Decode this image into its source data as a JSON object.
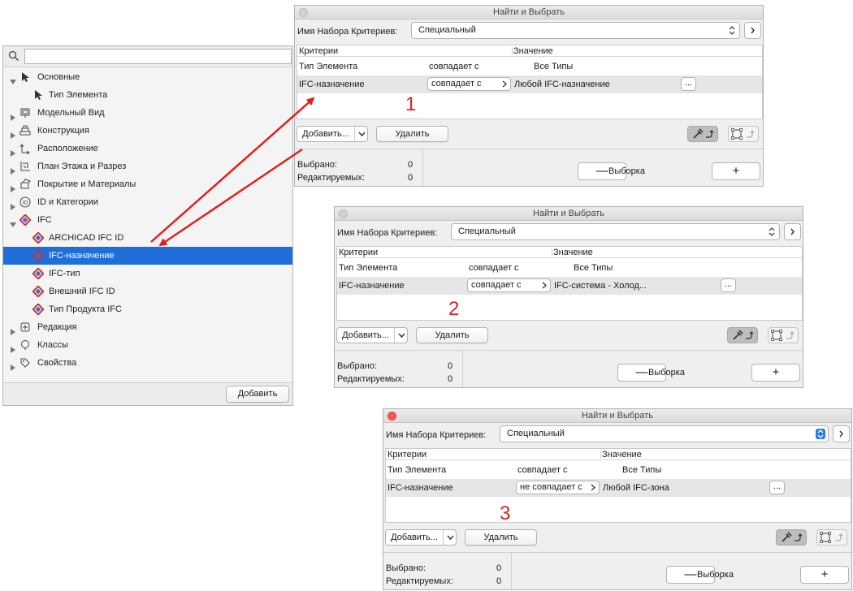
{
  "tree": {
    "search_value": "",
    "items": [
      {
        "label": "Основные",
        "level": 0,
        "expanded": true,
        "icon": "pointer-icon"
      },
      {
        "label": "Тип Элемента",
        "level": 1,
        "icon": "pointer-small-icon"
      },
      {
        "label": "Модельный Вид",
        "level": 0,
        "expanded": false,
        "icon": "model-view-icon"
      },
      {
        "label": "Конструкция",
        "level": 0,
        "expanded": false,
        "icon": "structure-icon"
      },
      {
        "label": "Расположение",
        "level": 0,
        "expanded": false,
        "icon": "location-icon"
      },
      {
        "label": "План Этажа и Разрез",
        "level": 0,
        "expanded": false,
        "icon": "floor-plan-icon"
      },
      {
        "label": "Покрытие и Материалы",
        "level": 0,
        "expanded": false,
        "icon": "surface-icon"
      },
      {
        "label": "ID и Категории",
        "level": 0,
        "expanded": false,
        "icon": "id-icon"
      },
      {
        "label": "IFC",
        "level": 0,
        "expanded": true,
        "icon": "ifc-icon"
      },
      {
        "label": "ARCHICAD IFC ID",
        "level": 1,
        "icon": "ifc-icon"
      },
      {
        "label": "IFC-назначение",
        "level": 1,
        "icon": "ifc-icon",
        "selected": true
      },
      {
        "label": "IFC-тип",
        "level": 1,
        "icon": "ifc-icon"
      },
      {
        "label": "Внешний IFC ID",
        "level": 1,
        "icon": "ifc-icon"
      },
      {
        "label": "Тип Продукта IFC",
        "level": 1,
        "icon": "ifc-icon"
      },
      {
        "label": "Редакция",
        "level": 0,
        "expanded": false,
        "icon": "revision-icon"
      },
      {
        "label": "Классы",
        "level": 0,
        "expanded": false,
        "icon": "classes-icon"
      },
      {
        "label": "Свойства",
        "level": 0,
        "expanded": false,
        "icon": "properties-icon"
      }
    ],
    "add_button": "Добавить"
  },
  "dialogs": [
    {
      "title": "Найти и Выбрать",
      "set_label": "Имя Набора Критериев:",
      "set_value": "Специальный",
      "col_criteria": "Критерии",
      "col_value": "Значение",
      "row1": {
        "criterion": "Тип Элемента",
        "op": "совпадает с",
        "value": "Все Типы"
      },
      "row2": {
        "criterion": "IFC-назначение",
        "op": "совпадает с",
        "value": "Любой IFC-назначение",
        "ellipsis": "..."
      },
      "step": "1",
      "add_label": "Добавить...",
      "delete_label": "Удалить",
      "selected_label": "Выбрано:",
      "selected_count": "0",
      "editable_label": "Редактируемых:",
      "editable_count": "0",
      "minus": "—",
      "selection_label": "Выборка",
      "plus": "+",
      "active": false
    },
    {
      "title": "Найти и Выбрать",
      "set_label": "Имя Набора Критериев:",
      "set_value": "Специальный",
      "col_criteria": "Критерии",
      "col_value": "Значение",
      "row1": {
        "criterion": "Тип Элемента",
        "op": "совпадает с",
        "value": "Все Типы"
      },
      "row2": {
        "criterion": "IFC-назначение",
        "op": "совпадает с",
        "value": "IFC-система - Холод...",
        "ellipsis": "..."
      },
      "step": "2",
      "add_label": "Добавить...",
      "delete_label": "Удалить",
      "selected_label": "Выбрано:",
      "selected_count": "0",
      "editable_label": "Редактируемых:",
      "editable_count": "0",
      "minus": "—",
      "selection_label": "Выборка",
      "plus": "+",
      "active": false
    },
    {
      "title": "Найти и Выбрать",
      "set_label": "Имя Набора Критериев:",
      "set_value": "Специальный",
      "col_criteria": "Критерии",
      "col_value": "Значение",
      "row1": {
        "criterion": "Тип Элемента",
        "op": "совпадает с",
        "value": "Все Типы"
      },
      "row2": {
        "criterion": "IFC-назначение",
        "op": "не совпадает с",
        "value": "Любой IFC-зона",
        "ellipsis": "..."
      },
      "step": "3",
      "add_label": "Добавить...",
      "delete_label": "Удалить",
      "selected_label": "Выбрано:",
      "selected_count": "0",
      "editable_label": "Редактируемых:",
      "editable_count": "0",
      "minus": "—",
      "selection_label": "Выборка",
      "plus": "+",
      "active": true
    }
  ],
  "colors": {
    "selection": "#1e6fd9",
    "arrow": "#e02020",
    "close_red": "#f25c55",
    "stepper_blue": "#2b7ae4"
  }
}
